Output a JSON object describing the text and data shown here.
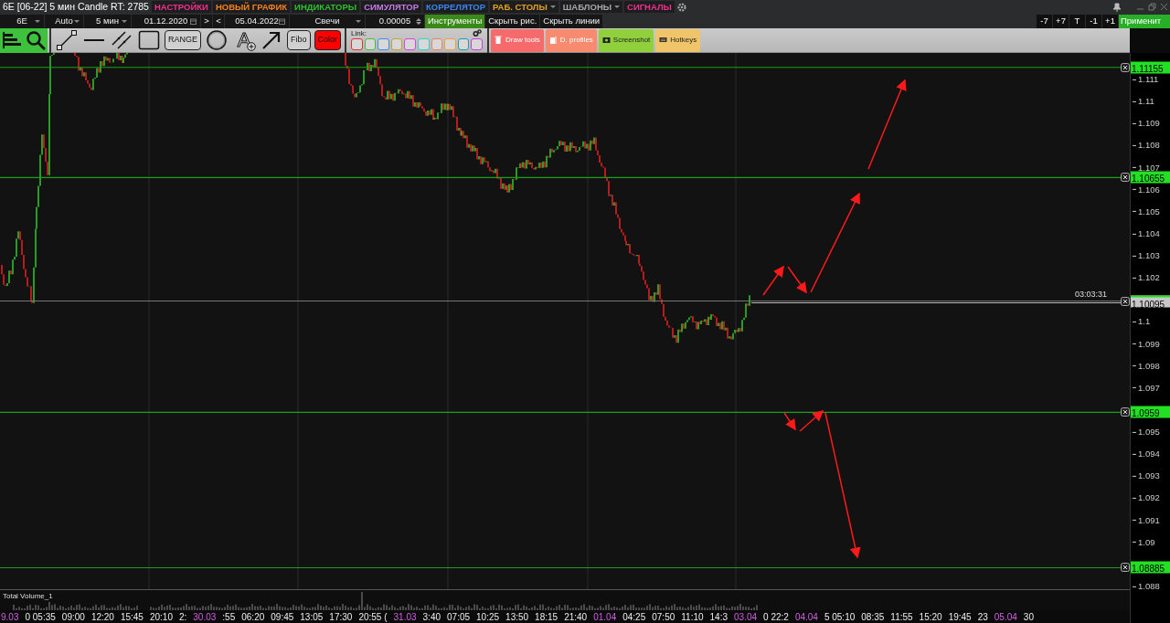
{
  "title": "6E [06-22] 5 мин Candle RT: 2785",
  "menu": [
    {
      "label": "НАСТРОЙКИ",
      "color": "#f0308c",
      "dropdown": false
    },
    {
      "label": "НОВЫЙ ГРАФИК",
      "color": "#f58020",
      "dropdown": false
    },
    {
      "label": "ИНДИКАТОРЫ",
      "color": "#2ec02e",
      "dropdown": false
    },
    {
      "label": "СИМУЛЯТОР",
      "color": "#c67ae8",
      "dropdown": false
    },
    {
      "label": "КОРРЕЛЯТОР",
      "color": "#3a86f0",
      "dropdown": false
    },
    {
      "label": "РАБ. СТОЛЫ",
      "color": "#e0a428",
      "dropdown": true
    },
    {
      "label": "ШАБЛОНЫ",
      "color": "#a8a8a8",
      "dropdown": true
    },
    {
      "label": "СИГНАЛЫ",
      "color": "#f0308c",
      "dropdown": false
    }
  ],
  "controls": [
    {
      "kind": "dropdown",
      "value": "6E"
    },
    {
      "kind": "dropdown",
      "value": "Auto"
    },
    {
      "kind": "dropdown",
      "value": "5 мин"
    },
    {
      "kind": "date",
      "value": "01.12.2020"
    },
    {
      "kind": "button",
      "value": ">"
    },
    {
      "kind": "button",
      "value": "<"
    },
    {
      "kind": "date",
      "value": "05.04.2022"
    },
    {
      "kind": "dropdown",
      "value": "Свечи"
    },
    {
      "kind": "spinner",
      "value": "0.00005"
    },
    {
      "kind": "primary",
      "value": "Инструменты"
    },
    {
      "kind": "button",
      "value": "Скрыть рис."
    },
    {
      "kind": "button",
      "value": "Скрыть линии"
    }
  ],
  "shift_buttons": [
    "-7",
    "+7",
    "T",
    "-1",
    "+1"
  ],
  "apply_button": "Применит",
  "range_button": "RANGE",
  "text_tool": "A",
  "fibo_button": "Fibo",
  "color_button": "Color",
  "link": {
    "label": "Link:",
    "slots": [
      {
        "color": "#e03030"
      },
      {
        "color": "#40c040"
      },
      {
        "color": "#3c8ce8"
      },
      {
        "color": "#c8a030"
      },
      {
        "color": "#e040e0"
      },
      {
        "color": "#30d0d0"
      },
      {
        "color": "#f08060"
      },
      {
        "color": "#f0a040"
      },
      {
        "color": "#20a0a0"
      },
      {
        "color": "#c040e0"
      }
    ]
  },
  "action_buttons": [
    {
      "label": "Draw tools",
      "color": "#f56a6a"
    },
    {
      "label": "D. profiles",
      "color": "#f88a70"
    },
    {
      "label": "Screenshot",
      "color": "#8fd03c"
    },
    {
      "label": "Hotkeys",
      "color": "#f0c468"
    }
  ],
  "levels": [
    {
      "price": "1.11155",
      "kind": "level"
    },
    {
      "price": "1.10655",
      "kind": "level"
    },
    {
      "price": "1.10095",
      "kind": "current",
      "timer": "03:03:31"
    },
    {
      "price": "1.0959",
      "kind": "level"
    },
    {
      "price": "1.08885",
      "kind": "level"
    }
  ],
  "price_ticks": [
    "1.111",
    "1.11",
    "1.109",
    "1.108",
    "1.107",
    "1.106",
    "1.105",
    "1.104",
    "1.103",
    "1.102",
    "1.1",
    "1.099",
    "1.098",
    "1.097",
    "1.095",
    "1.094",
    "1.093",
    "1.092",
    "1.091",
    "1.09",
    "1.088"
  ],
  "volume_pane": {
    "title": "Total Volume_1"
  },
  "time_axis": [
    {
      "label": "9.03",
      "kind": "date"
    },
    {
      "label": "0 05:35",
      "kind": "time"
    },
    {
      "label": "09:00",
      "kind": "time"
    },
    {
      "label": "12:20",
      "kind": "time"
    },
    {
      "label": "15:45",
      "kind": "time"
    },
    {
      "label": "20:10",
      "kind": "time"
    },
    {
      "label": "2:",
      "kind": "time"
    },
    {
      "label": "30.03",
      "kind": "date"
    },
    {
      "label": ":55",
      "kind": "time"
    },
    {
      "label": "06:20",
      "kind": "time"
    },
    {
      "label": "09:45",
      "kind": "time"
    },
    {
      "label": "13:05",
      "kind": "time"
    },
    {
      "label": "17:30",
      "kind": "time"
    },
    {
      "label": "20:55 (",
      "kind": "time"
    },
    {
      "label": "31.03",
      "kind": "date"
    },
    {
      "label": "3:40",
      "kind": "time"
    },
    {
      "label": "07:05",
      "kind": "time"
    },
    {
      "label": "10:25",
      "kind": "time"
    },
    {
      "label": "13:50",
      "kind": "time"
    },
    {
      "label": "18:15",
      "kind": "time"
    },
    {
      "label": "21:40",
      "kind": "time"
    },
    {
      "label": "01.04",
      "kind": "date"
    },
    {
      "label": "04:25",
      "kind": "time"
    },
    {
      "label": "07:50",
      "kind": "time"
    },
    {
      "label": "11:10",
      "kind": "time"
    },
    {
      "label": "14:3",
      "kind": "time"
    },
    {
      "label": "03.04",
      "kind": "date"
    },
    {
      "label": "0 22:2",
      "kind": "time"
    },
    {
      "label": "04.04",
      "kind": "date"
    },
    {
      "label": "5 05:10",
      "kind": "time"
    },
    {
      "label": "08:35",
      "kind": "time"
    },
    {
      "label": "11:55",
      "kind": "time"
    },
    {
      "label": "15:20",
      "kind": "time"
    },
    {
      "label": "19:45",
      "kind": "time"
    },
    {
      "label": "23",
      "kind": "time"
    },
    {
      "label": "05.04",
      "kind": "date"
    },
    {
      "label": "30",
      "kind": "time"
    }
  ]
}
